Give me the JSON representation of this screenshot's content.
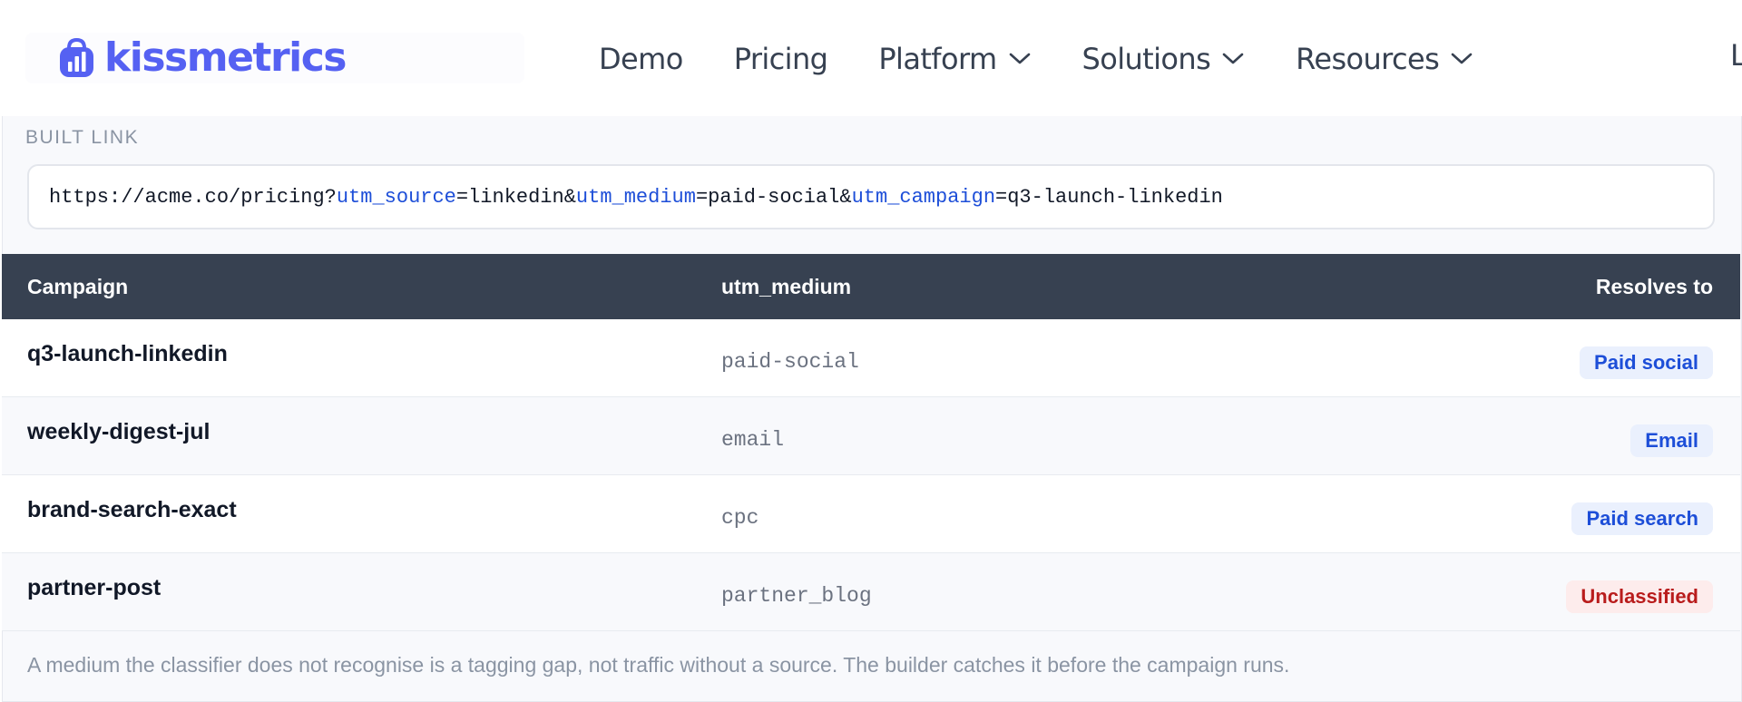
{
  "header": {
    "logo_text": "kissmetrics",
    "nav": [
      {
        "label": "Demo",
        "dropdown": false
      },
      {
        "label": "Pricing",
        "dropdown": false
      },
      {
        "label": "Platform",
        "dropdown": true
      },
      {
        "label": "Solutions",
        "dropdown": true
      },
      {
        "label": "Resources",
        "dropdown": true
      }
    ],
    "nav_cut_label": "L"
  },
  "builder": {
    "section_label": "BUILT LINK",
    "link_parts": {
      "base": "https://acme.co/pricing?",
      "p1_key": "utm_source",
      "p1_val": "=linkedin&",
      "p2_key": "utm_medium",
      "p2_val": "=paid-social&",
      "p3_key": "utm_campaign",
      "p3_val": "=q3-launch-linkedin"
    }
  },
  "table": {
    "headers": {
      "campaign": "Campaign",
      "medium": "utm_medium",
      "resolves": "Resolves to"
    },
    "rows": [
      {
        "campaign": "q3-launch-linkedin",
        "medium": "paid-social",
        "resolves": "Paid social",
        "status": "ok"
      },
      {
        "campaign": "weekly-digest-jul",
        "medium": "email",
        "resolves": "Email",
        "status": "ok"
      },
      {
        "campaign": "brand-search-exact",
        "medium": "cpc",
        "resolves": "Paid search",
        "status": "ok"
      },
      {
        "campaign": "partner-post",
        "medium": "partner_blog",
        "resolves": "Unclassified",
        "status": "error"
      }
    ]
  },
  "footnote": "A medium the classifier does not recognise is a tagging gap, not traffic without a source. The builder catches it before the campaign runs.",
  "colors": {
    "brand": "#5561f2",
    "param": "#1d4ed8",
    "header_bg": "#374151",
    "badge_ok_bg": "#eaf0fd",
    "badge_error_text": "#b91c1c"
  },
  "icons": {
    "logo": "bar-chart-bag-icon",
    "dropdown": "chevron-down-icon"
  }
}
